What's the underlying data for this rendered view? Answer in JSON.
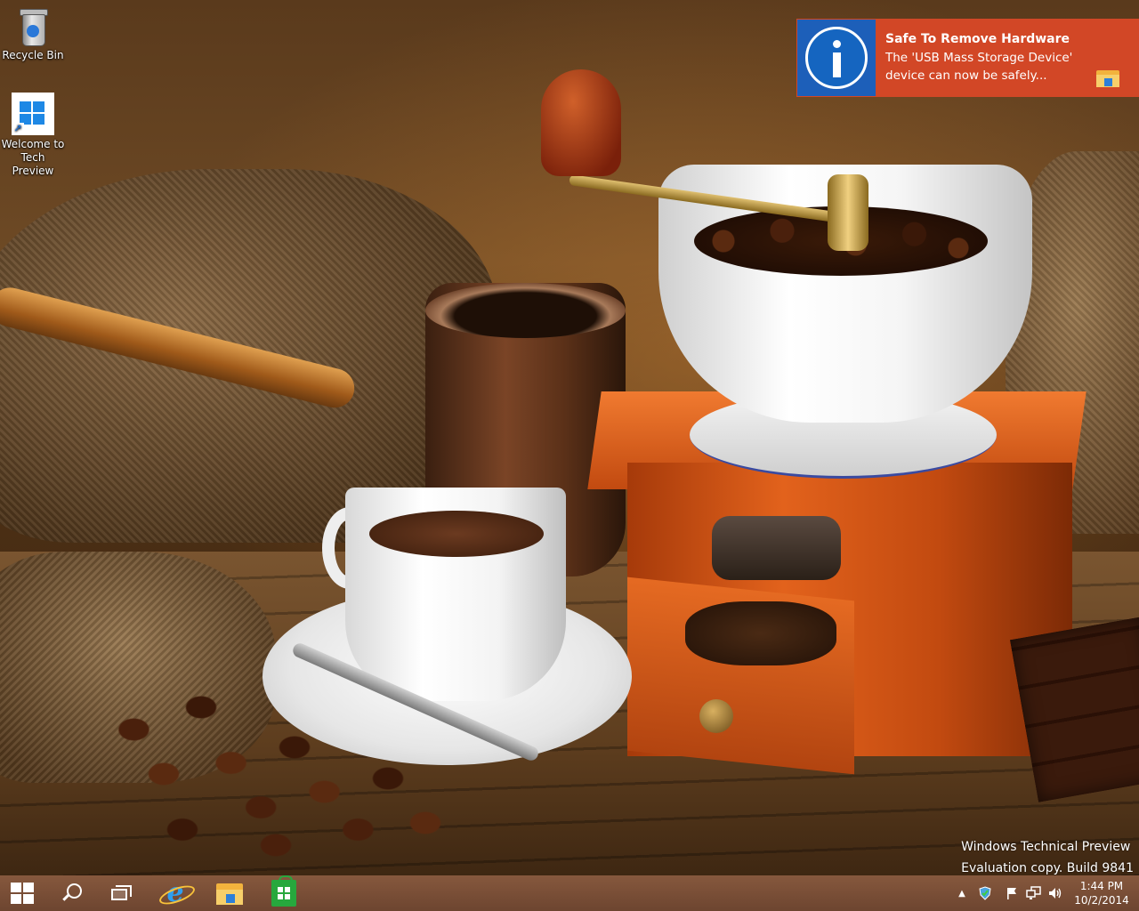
{
  "desktop": {
    "icons": [
      {
        "label": "Recycle Bin",
        "icon": "recycle-bin-icon"
      },
      {
        "label": "Welcome to Tech Preview",
        "label_line1": "Welcome to",
        "label_line2": "Tech Preview",
        "icon": "windows-logo-icon"
      }
    ]
  },
  "notification": {
    "title": "Safe To Remove Hardware",
    "body_line1": "The 'USB Mass Storage Device'",
    "body_line2": "device can now be safely...",
    "icon": "info-icon",
    "app_icon": "file-explorer-icon",
    "background_color": "#d24726",
    "icon_tile_color": "#1d5fb9"
  },
  "watermark": {
    "line1": "Windows Technical Preview",
    "line2": "Evaluation copy. Build 9841"
  },
  "taskbar": {
    "buttons": [
      {
        "name": "start",
        "icon": "windows-logo-icon"
      },
      {
        "name": "search",
        "icon": "search-icon"
      },
      {
        "name": "task-view",
        "icon": "task-view-icon"
      },
      {
        "name": "internet-explorer",
        "icon": "internet-explorer-icon"
      },
      {
        "name": "file-explorer",
        "icon": "file-explorer-icon"
      },
      {
        "name": "store",
        "icon": "store-icon"
      }
    ],
    "tray": {
      "icons": [
        "chevron-up-icon",
        "security-shield-icon",
        "action-center-flag-icon",
        "network-icon",
        "volume-icon"
      ],
      "chevron_glyph": "▲",
      "time": "1:44 PM",
      "date": "10/2/2014"
    },
    "color": "#7a4e36"
  }
}
